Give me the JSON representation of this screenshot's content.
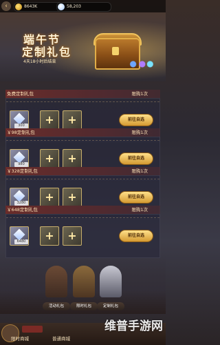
{
  "topbar": {
    "gold_amount": "8643K",
    "gem_amount": "58,203",
    "gold_icon": "gold-coin-icon",
    "gem_icon": "diamond-icon"
  },
  "banner": {
    "title_line1": "端午节",
    "title_line2": "定制礼包",
    "timer": "4天18小时后结束"
  },
  "packages": [
    {
      "name": "免费定制礼包",
      "limit": "限购1次",
      "count": "300",
      "button": "前往自选"
    },
    {
      "name": "￥98定制礼包",
      "limit": "限购1次",
      "count": "980",
      "button": "前往自选"
    },
    {
      "name": "￥328定制礼包",
      "limit": "限购1次",
      "count": "3280",
      "button": "前往自选"
    },
    {
      "name": "￥648定制礼包",
      "limit": "限购1次",
      "count": "6480",
      "button": "前往自选"
    }
  ],
  "characters": [
    {
      "label": "活动礼包"
    },
    {
      "label": "限时礼包"
    },
    {
      "label": "定制礼包"
    }
  ],
  "bottom_nav": {
    "item1": "限时商城",
    "item2": "普通商城"
  },
  "watermark": "维普手游网",
  "colors": {
    "accent_gold": "#d49a32",
    "header_red": "#6a2c2a"
  }
}
